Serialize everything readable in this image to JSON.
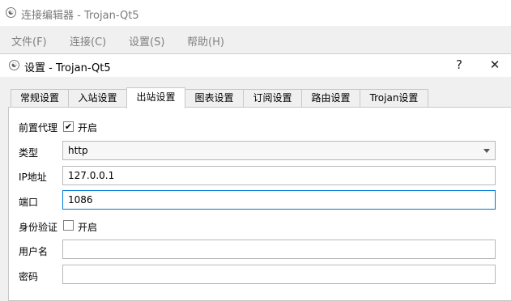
{
  "main_window": {
    "icon": "trojan-app-icon",
    "title": "连接编辑器 - Trojan-Qt5",
    "menu": [
      "文件(F)",
      "连接(C)",
      "设置(S)",
      "帮助(H)"
    ]
  },
  "dialog": {
    "icon": "trojan-app-icon",
    "title": "设置 - Trojan-Qt5",
    "help_glyph": "?",
    "close_glyph": "✕",
    "tabs": [
      "常规设置",
      "入站设置",
      "出站设置",
      "图表设置",
      "订阅设置",
      "路由设置",
      "Trojan设置"
    ],
    "active_tab": "出站设置",
    "form": {
      "front_proxy": {
        "label": "前置代理",
        "checkbox_label": "开启",
        "checked": true
      },
      "type": {
        "label": "类型",
        "value": "http"
      },
      "ip": {
        "label": "IP地址",
        "value": "127.0.0.1"
      },
      "port": {
        "label": "端口",
        "value": "1086"
      },
      "auth": {
        "label": "身份验证",
        "checkbox_label": "开启",
        "checked": false
      },
      "username": {
        "label": "用户名",
        "value": ""
      },
      "password": {
        "label": "密码",
        "value": ""
      }
    }
  },
  "colors": {
    "focus_border": "#0078d7",
    "tab_border": "#c8c8c8",
    "menu_text": "#808080"
  }
}
